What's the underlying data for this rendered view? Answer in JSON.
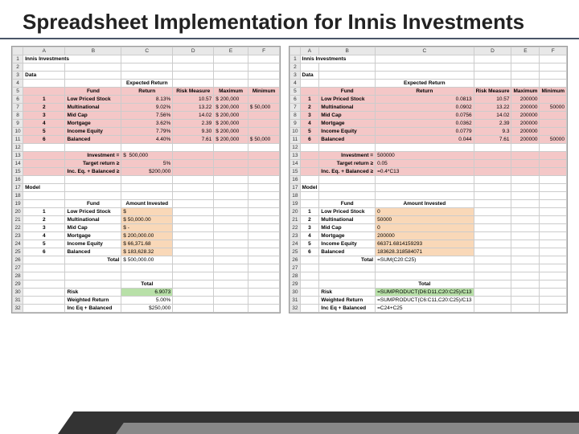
{
  "title": "Spreadsheet Implementation for Innis Investments",
  "left": {
    "heading": "Innis Investments",
    "data_label": "Data",
    "hdr_fund": "Fund",
    "hdr_exp": "Expected Return",
    "hdr_risk": "Risk Measure",
    "hdr_max": "Maximum",
    "hdr_min": "Minimum",
    "rows": [
      {
        "n": "1",
        "fund": "Low Priced Stock",
        "er": "8.13%",
        "risk": "10.57",
        "max_s": "$",
        "max": "200,000",
        "min": ""
      },
      {
        "n": "2",
        "fund": "Multinational",
        "er": "9.02%",
        "risk": "13.22",
        "max_s": "$",
        "max": "200,000",
        "min_s": "$",
        "min": "50,000"
      },
      {
        "n": "3",
        "fund": "Mid Cap",
        "er": "7.56%",
        "risk": "14.02",
        "max_s": "$",
        "max": "200,000",
        "min": ""
      },
      {
        "n": "4",
        "fund": "Mortgage",
        "er": "3.62%",
        "risk": "2.39",
        "max_s": "$",
        "max": "200,000",
        "min": ""
      },
      {
        "n": "5",
        "fund": "Income Equity",
        "er": "7.79%",
        "risk": "9.30",
        "max_s": "$",
        "max": "200,000",
        "min": ""
      },
      {
        "n": "6",
        "fund": "Balanced",
        "er": "4.40%",
        "risk": "7.61",
        "max_s": "$",
        "max": "200,000",
        "min_s": "$",
        "min": "50,000"
      }
    ],
    "inv_label": "Investment =",
    "inv_s": "$",
    "inv": "500,000",
    "tgt_label": "Target return ≥",
    "tgt": "5%",
    "bal_label": "Inc. Eq. + Balanced ≥",
    "bal": "$200,000",
    "model": "Model",
    "m_fund": "Fund",
    "m_amt": "Amount Invested",
    "mrows": [
      {
        "n": "1",
        "fund": "Low Priced Stock",
        "s": "$",
        "amt": ""
      },
      {
        "n": "2",
        "fund": "Multinational",
        "s": "$",
        "amt": "50,000.00"
      },
      {
        "n": "3",
        "fund": "Mid Cap",
        "s": "$",
        "amt": "-"
      },
      {
        "n": "4",
        "fund": "Mortgage",
        "s": "$",
        "amt": "200,000.00"
      },
      {
        "n": "5",
        "fund": "Income Equity",
        "s": "$",
        "amt": "66,371.68"
      },
      {
        "n": "6",
        "fund": "Balanced",
        "s": "$",
        "amt": "183,628.32"
      }
    ],
    "total_label": "Total",
    "total_s": "$",
    "total": "500,000.00",
    "t2": "Total",
    "risk_lbl": "Risk",
    "risk_val": "6.9073",
    "wr_lbl": "Weighted Return",
    "wr_val": "5.00%",
    "ieb_lbl": "Inc Eq + Balanced",
    "ieb": "$250,000"
  },
  "right": {
    "heading": "Innis Investments",
    "data_label": "Data",
    "hdr_fund": "Fund",
    "hdr_exp": "Expected Return",
    "hdr_risk": "Risk Measure",
    "hdr_max": "Maximum",
    "hdr_min": "Minimum",
    "rows": [
      {
        "n": "1",
        "fund": "Low Priced Stock",
        "er": "0.0813",
        "risk": "10.57",
        "max": "200000",
        "min": ""
      },
      {
        "n": "2",
        "fund": "Multinational",
        "er": "0.0902",
        "risk": "13.22",
        "max": "200000",
        "min": "50000"
      },
      {
        "n": "3",
        "fund": "Mid Cap",
        "er": "0.0756",
        "risk": "14.02",
        "max": "200000",
        "min": ""
      },
      {
        "n": "4",
        "fund": "Mortgage",
        "er": "0.0362",
        "risk": "2.39",
        "max": "200000",
        "min": ""
      },
      {
        "n": "5",
        "fund": "Income Equity",
        "er": "0.0779",
        "risk": "9.3",
        "max": "200000",
        "min": ""
      },
      {
        "n": "6",
        "fund": "Balanced",
        "er": "0.044",
        "risk": "7.61",
        "max": "200000",
        "min": "50000"
      }
    ],
    "inv_label": "Investment =",
    "inv": "500000",
    "tgt_label": "Target return ≥",
    "tgt": "0.05",
    "bal_label": "Inc. Eq. + Balanced ≥",
    "bal": "=0.4*C13",
    "model": "Model",
    "m_fund": "Fund",
    "m_amt": "Amount Invested",
    "mrows": [
      {
        "n": "1",
        "fund": "Low Priced Stock",
        "amt": "0"
      },
      {
        "n": "2",
        "fund": "Multinational",
        "amt": "50000"
      },
      {
        "n": "3",
        "fund": "Mid Cap",
        "amt": "0"
      },
      {
        "n": "4",
        "fund": "Mortgage",
        "amt": "200000"
      },
      {
        "n": "5",
        "fund": "Income Equity",
        "amt": "66371.6814159293"
      },
      {
        "n": "6",
        "fund": "Balanced",
        "amt": "183628.318584071"
      }
    ],
    "total_label": "Total",
    "total": "=SUM(C20:C25)",
    "t2": "Total",
    "risk_lbl": "Risk",
    "risk_val": "=SUMPRODUCT(D6:D11,C20:C25)/C13",
    "wr_lbl": "Weighted Return",
    "wr_val": "=SUMPRODUCT(C6:C11,C20:C25)/C13",
    "ieb_lbl": "Inc Eq + Balanced",
    "ieb": "=C24+C25"
  }
}
